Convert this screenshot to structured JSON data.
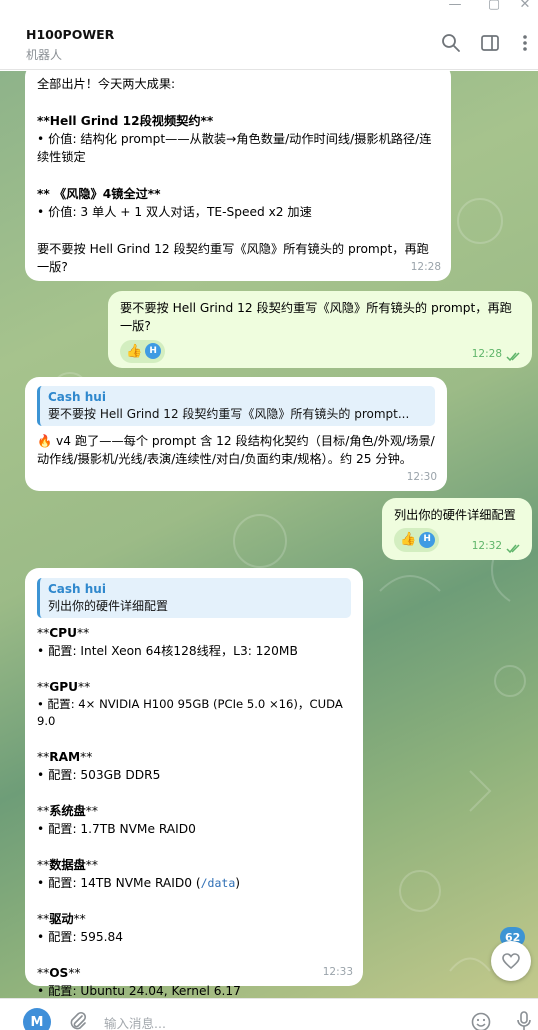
{
  "window": {
    "controls": [
      "—",
      "▢",
      "✕"
    ]
  },
  "header": {
    "title": "H100POWER",
    "subtitle": "机器人",
    "icons": [
      "search-icon",
      "sidebar-toggle-icon",
      "more-vertical-icon"
    ]
  },
  "messages": {
    "m1": {
      "lines": [
        "全部出片！今天两大成果:",
        "",
        "**Hell Grind 12段视频契约**",
        "• 价值: 结构化 prompt——从散装→角色数量/动作时间线/摄影机路径/连续性锁定",
        "",
        "** 《风隐》4镜全过**",
        "• 价值: 3 单人 + 1 双人对话，TE-Speed x2 加速",
        "",
        "要不要按 Hell Grind 12 段契约重写《风隐》所有镜头的 prompt，再跑一版?"
      ],
      "time": "12:28"
    },
    "m2": {
      "text": "要不要按 Hell Grind 12 段契约重写《风隐》所有镜头的 prompt，再跑一版?",
      "reaction": "👍",
      "reaction_avatar": "H",
      "time": "12:28"
    },
    "m3": {
      "reply_name": "Cash hui",
      "reply_text": "要不要按 Hell Grind 12 段契约重写《风隐》所有镜头的 prompt...",
      "text": "🔥 v4 跑了——每个 prompt 含 12 段结构化契约（目标/角色/外观/场景/动作线/摄影机/光线/表演/连续性/对白/负面约束/规格）。约 25 分钟。",
      "time": "12:30"
    },
    "m4": {
      "text": "列出你的硬件详细配置",
      "reaction": "👍",
      "reaction_avatar": "H",
      "time": "12:32"
    },
    "m5": {
      "reply_name": "Cash hui",
      "reply_text": "列出你的硬件详细配置",
      "sections": [
        {
          "h_pre": "**",
          "h_bold": "CPU",
          "h_post": "**",
          "body": "• 配置: Intel Xeon 64核128线程，L3: 120MB"
        },
        {
          "h_pre": "**",
          "h_bold": "GPU",
          "h_post": "**",
          "body": "• 配置: 4× NVIDIA H100 95GB (PCIe 5.0 ×16)，CUDA 9.0"
        },
        {
          "h_pre": "**",
          "h_bold": "RAM",
          "h_post": "**",
          "body": "• 配置: 503GB DDR5"
        },
        {
          "h_pre": "**",
          "h_bold": "系统盘",
          "h_post": "**",
          "body": "• 配置: 1.7TB NVMe RAID0"
        },
        {
          "h_pre": "**",
          "h_bold": "数据盘",
          "h_post": "**",
          "body_pre": "• 配置: 14TB NVMe RAID0 (",
          "body_code": "/data",
          "body_post": ")"
        },
        {
          "h_pre": "**",
          "h_bold": "驱动",
          "h_post": "**",
          "body": "• 配置: 595.84"
        },
        {
          "h_pre": "**",
          "h_bold": "OS",
          "h_post": "**",
          "body": "• 配置: Ubuntu 24.04, Kernel 6.17"
        }
      ],
      "time": "12:33"
    }
  },
  "unread_badge": "62",
  "composer": {
    "avatar_letter": "M",
    "placeholder": "输入消息..."
  },
  "colors": {
    "accent": "#3c94d4",
    "out_bubble": "#effdde",
    "in_bubble": "#ffffff"
  }
}
